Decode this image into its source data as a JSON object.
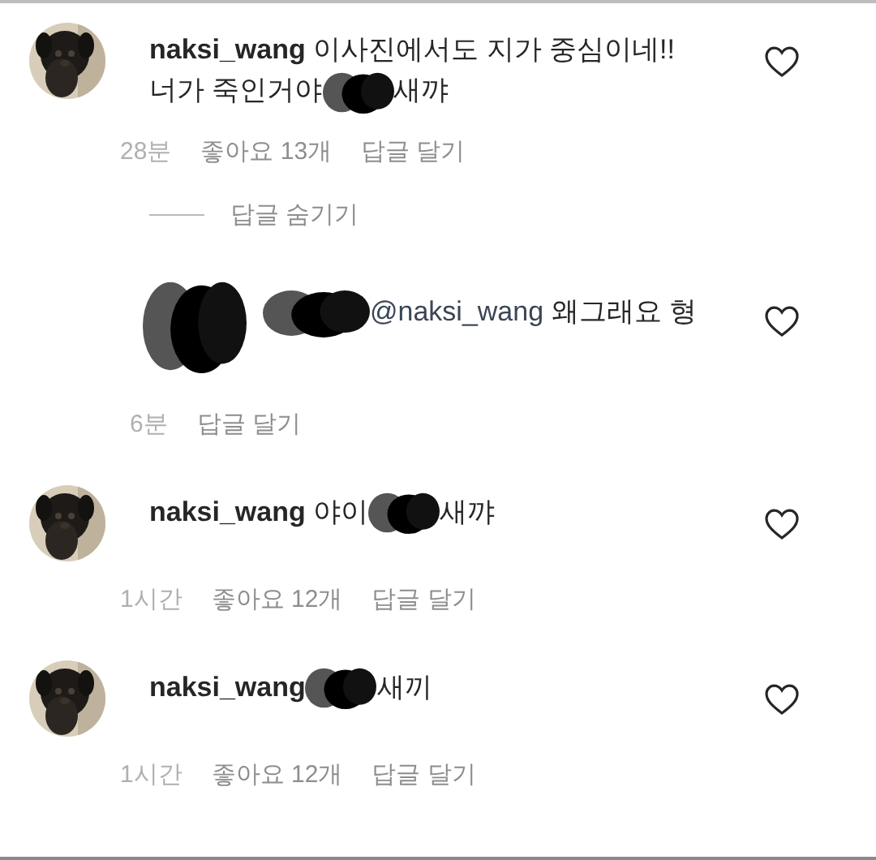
{
  "comments": [
    {
      "avatar": {
        "kind": "picture"
      },
      "author": "naksi_wang",
      "body": [
        {
          "kind": "text",
          "text": "이사진에서도 지가 중심이네!!"
        },
        {
          "kind": "newline"
        },
        {
          "kind": "text",
          "text": "너가 죽인거야"
        },
        {
          "kind": "redaction"
        },
        {
          "kind": "text",
          "text": "새꺄"
        }
      ],
      "liked": false,
      "time": "28분",
      "likes": "좋아요 13개",
      "reply_action": "답글 달기",
      "hide_replies": "답글 숨기기",
      "replies": [
        {
          "avatar": {
            "kind": "redaction"
          },
          "body": [
            {
              "kind": "redaction"
            },
            {
              "kind": "mention",
              "text": "@naksi_wang"
            },
            {
              "kind": "text",
              "text": "왜그래요 형"
            }
          ],
          "liked": false,
          "time": "6분",
          "reply_action": "답글 달기"
        }
      ]
    },
    {
      "avatar": {
        "kind": "picture"
      },
      "author": "naksi_wang",
      "body": [
        {
          "kind": "text",
          "text": "야이"
        },
        {
          "kind": "redaction"
        },
        {
          "kind": "text",
          "text": "새꺄"
        }
      ],
      "liked": false,
      "time": "1시간",
      "likes": "좋아요 12개",
      "reply_action": "답글 달기"
    },
    {
      "avatar": {
        "kind": "picture"
      },
      "author": "naksi_wang",
      "body": [
        {
          "kind": "redaction"
        },
        {
          "kind": "text",
          "text": "새끼"
        }
      ],
      "liked": false,
      "time": "1시간",
      "likes": "좋아요 12개",
      "reply_action": "답글 달기"
    }
  ]
}
